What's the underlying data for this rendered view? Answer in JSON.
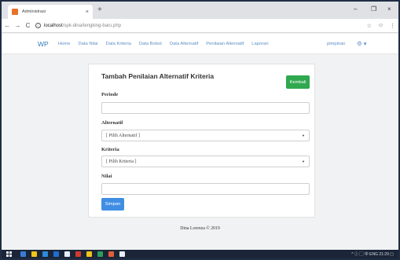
{
  "browser": {
    "tab_title": "Administrasi",
    "tab_close": "×",
    "new_tab": "+",
    "window_controls": [
      "–",
      "❐",
      "×"
    ],
    "nav_buttons": [
      "←",
      "→",
      "C"
    ],
    "info_glyph": "i",
    "url_host": "localhost",
    "url_path": "/spk-dina/tengking-baru.php",
    "bar_icons": [
      "☆",
      "☺",
      "⋮"
    ]
  },
  "app": {
    "brand": "WP",
    "menu": [
      "Home",
      "Data Nilai",
      "Data Kriteria",
      "Data Bobot",
      "Data Alternatif",
      "Penilaian Alternatif",
      "Laporan"
    ],
    "user": "pimpinan",
    "gear": "⚙ ▾"
  },
  "form": {
    "title": "Tambah Penilaian Alternatif Kriteria",
    "back_button": "Kembali",
    "periode_label": "Periode",
    "periode_value": "",
    "alternatif_label": "Alternatif",
    "alternatif_selected": "[ Pilih Alternatif ]",
    "kriteria_label": "Kriteria",
    "kriteria_selected": "[ Pilih Kriteria ]",
    "nilai_label": "Nilai",
    "nilai_value": "",
    "save_button": "Simpan",
    "caret": "▼"
  },
  "footer": {
    "text": "Dina Lorenza © 2019"
  },
  "taskbar": {
    "icon_colors": [
      "#e8eef8",
      "#3a7bd5",
      "#f0c419",
      "#2e8bd8",
      "#1e6fd0",
      "#e8eef8",
      "#d23a2f",
      "#f0c419",
      "#2a9d5c",
      "#e35d3a"
    ],
    "tray": "^ ⓘ ▢ 中 ENG 21:29 ▢"
  }
}
